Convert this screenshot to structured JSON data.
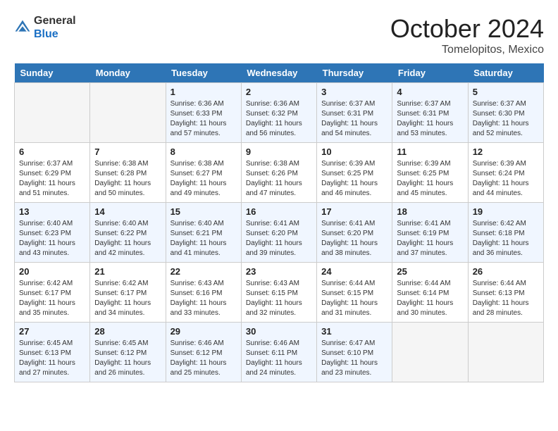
{
  "header": {
    "logo_general": "General",
    "logo_blue": "Blue",
    "month": "October 2024",
    "location": "Tomelopitos, Mexico"
  },
  "days_of_week": [
    "Sunday",
    "Monday",
    "Tuesday",
    "Wednesday",
    "Thursday",
    "Friday",
    "Saturday"
  ],
  "weeks": [
    [
      {
        "day": "",
        "sunrise": "",
        "sunset": "",
        "daylight": ""
      },
      {
        "day": "",
        "sunrise": "",
        "sunset": "",
        "daylight": ""
      },
      {
        "day": "1",
        "sunrise": "Sunrise: 6:36 AM",
        "sunset": "Sunset: 6:33 PM",
        "daylight": "Daylight: 11 hours and 57 minutes."
      },
      {
        "day": "2",
        "sunrise": "Sunrise: 6:36 AM",
        "sunset": "Sunset: 6:32 PM",
        "daylight": "Daylight: 11 hours and 56 minutes."
      },
      {
        "day": "3",
        "sunrise": "Sunrise: 6:37 AM",
        "sunset": "Sunset: 6:31 PM",
        "daylight": "Daylight: 11 hours and 54 minutes."
      },
      {
        "day": "4",
        "sunrise": "Sunrise: 6:37 AM",
        "sunset": "Sunset: 6:31 PM",
        "daylight": "Daylight: 11 hours and 53 minutes."
      },
      {
        "day": "5",
        "sunrise": "Sunrise: 6:37 AM",
        "sunset": "Sunset: 6:30 PM",
        "daylight": "Daylight: 11 hours and 52 minutes."
      }
    ],
    [
      {
        "day": "6",
        "sunrise": "Sunrise: 6:37 AM",
        "sunset": "Sunset: 6:29 PM",
        "daylight": "Daylight: 11 hours and 51 minutes."
      },
      {
        "day": "7",
        "sunrise": "Sunrise: 6:38 AM",
        "sunset": "Sunset: 6:28 PM",
        "daylight": "Daylight: 11 hours and 50 minutes."
      },
      {
        "day": "8",
        "sunrise": "Sunrise: 6:38 AM",
        "sunset": "Sunset: 6:27 PM",
        "daylight": "Daylight: 11 hours and 49 minutes."
      },
      {
        "day": "9",
        "sunrise": "Sunrise: 6:38 AM",
        "sunset": "Sunset: 6:26 PM",
        "daylight": "Daylight: 11 hours and 47 minutes."
      },
      {
        "day": "10",
        "sunrise": "Sunrise: 6:39 AM",
        "sunset": "Sunset: 6:25 PM",
        "daylight": "Daylight: 11 hours and 46 minutes."
      },
      {
        "day": "11",
        "sunrise": "Sunrise: 6:39 AM",
        "sunset": "Sunset: 6:25 PM",
        "daylight": "Daylight: 11 hours and 45 minutes."
      },
      {
        "day": "12",
        "sunrise": "Sunrise: 6:39 AM",
        "sunset": "Sunset: 6:24 PM",
        "daylight": "Daylight: 11 hours and 44 minutes."
      }
    ],
    [
      {
        "day": "13",
        "sunrise": "Sunrise: 6:40 AM",
        "sunset": "Sunset: 6:23 PM",
        "daylight": "Daylight: 11 hours and 43 minutes."
      },
      {
        "day": "14",
        "sunrise": "Sunrise: 6:40 AM",
        "sunset": "Sunset: 6:22 PM",
        "daylight": "Daylight: 11 hours and 42 minutes."
      },
      {
        "day": "15",
        "sunrise": "Sunrise: 6:40 AM",
        "sunset": "Sunset: 6:21 PM",
        "daylight": "Daylight: 11 hours and 41 minutes."
      },
      {
        "day": "16",
        "sunrise": "Sunrise: 6:41 AM",
        "sunset": "Sunset: 6:20 PM",
        "daylight": "Daylight: 11 hours and 39 minutes."
      },
      {
        "day": "17",
        "sunrise": "Sunrise: 6:41 AM",
        "sunset": "Sunset: 6:20 PM",
        "daylight": "Daylight: 11 hours and 38 minutes."
      },
      {
        "day": "18",
        "sunrise": "Sunrise: 6:41 AM",
        "sunset": "Sunset: 6:19 PM",
        "daylight": "Daylight: 11 hours and 37 minutes."
      },
      {
        "day": "19",
        "sunrise": "Sunrise: 6:42 AM",
        "sunset": "Sunset: 6:18 PM",
        "daylight": "Daylight: 11 hours and 36 minutes."
      }
    ],
    [
      {
        "day": "20",
        "sunrise": "Sunrise: 6:42 AM",
        "sunset": "Sunset: 6:17 PM",
        "daylight": "Daylight: 11 hours and 35 minutes."
      },
      {
        "day": "21",
        "sunrise": "Sunrise: 6:42 AM",
        "sunset": "Sunset: 6:17 PM",
        "daylight": "Daylight: 11 hours and 34 minutes."
      },
      {
        "day": "22",
        "sunrise": "Sunrise: 6:43 AM",
        "sunset": "Sunset: 6:16 PM",
        "daylight": "Daylight: 11 hours and 33 minutes."
      },
      {
        "day": "23",
        "sunrise": "Sunrise: 6:43 AM",
        "sunset": "Sunset: 6:15 PM",
        "daylight": "Daylight: 11 hours and 32 minutes."
      },
      {
        "day": "24",
        "sunrise": "Sunrise: 6:44 AM",
        "sunset": "Sunset: 6:15 PM",
        "daylight": "Daylight: 11 hours and 31 minutes."
      },
      {
        "day": "25",
        "sunrise": "Sunrise: 6:44 AM",
        "sunset": "Sunset: 6:14 PM",
        "daylight": "Daylight: 11 hours and 30 minutes."
      },
      {
        "day": "26",
        "sunrise": "Sunrise: 6:44 AM",
        "sunset": "Sunset: 6:13 PM",
        "daylight": "Daylight: 11 hours and 28 minutes."
      }
    ],
    [
      {
        "day": "27",
        "sunrise": "Sunrise: 6:45 AM",
        "sunset": "Sunset: 6:13 PM",
        "daylight": "Daylight: 11 hours and 27 minutes."
      },
      {
        "day": "28",
        "sunrise": "Sunrise: 6:45 AM",
        "sunset": "Sunset: 6:12 PM",
        "daylight": "Daylight: 11 hours and 26 minutes."
      },
      {
        "day": "29",
        "sunrise": "Sunrise: 6:46 AM",
        "sunset": "Sunset: 6:12 PM",
        "daylight": "Daylight: 11 hours and 25 minutes."
      },
      {
        "day": "30",
        "sunrise": "Sunrise: 6:46 AM",
        "sunset": "Sunset: 6:11 PM",
        "daylight": "Daylight: 11 hours and 24 minutes."
      },
      {
        "day": "31",
        "sunrise": "Sunrise: 6:47 AM",
        "sunset": "Sunset: 6:10 PM",
        "daylight": "Daylight: 11 hours and 23 minutes."
      },
      {
        "day": "",
        "sunrise": "",
        "sunset": "",
        "daylight": ""
      },
      {
        "day": "",
        "sunrise": "",
        "sunset": "",
        "daylight": ""
      }
    ]
  ]
}
